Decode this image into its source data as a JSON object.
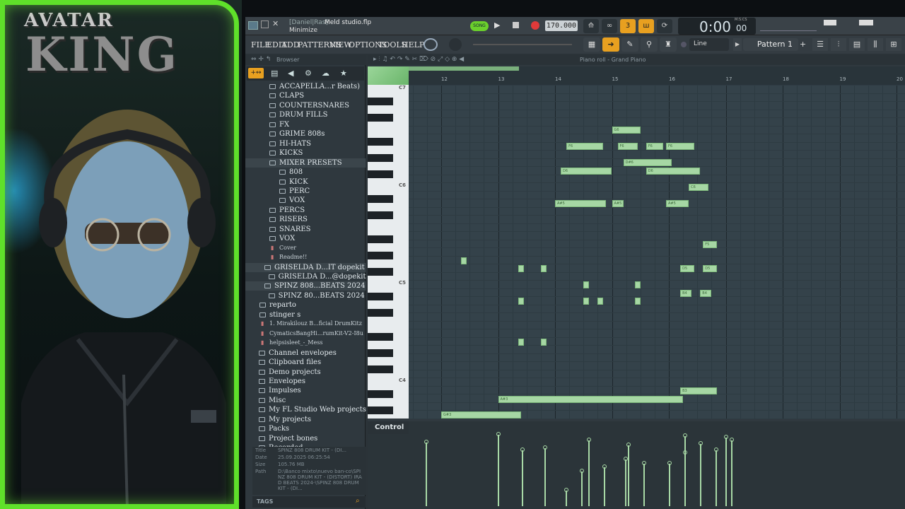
{
  "overlay": {
    "logo_top": "AVATAR",
    "logo_big": "KING"
  },
  "fl": {
    "title_user": "[Daniel|Ras]",
    "title_file": "Meld studio.flp",
    "title_hint": "Minimize",
    "song_toggle": "SONG",
    "tempo": "170.000",
    "time": "0:00",
    "time_small": "00",
    "time_unit": "M:S:CS",
    "menus": [
      "FILE",
      "EDIT",
      "ADD",
      "PATTERNS",
      "VIEW",
      "OPTIONS",
      "TOOLS",
      "HELP"
    ],
    "snap": "Line",
    "pattern": "Pattern 1",
    "browser_label": "Browser",
    "piano_roll_label": "Piano roll - Grand Piano",
    "control_label": "Control",
    "tags_label": "TAGS"
  },
  "browser_items": [
    {
      "label": "ACCAPELLA...r Beats)",
      "indent": 1
    },
    {
      "label": "CLAPS",
      "indent": 1
    },
    {
      "label": "COUNTERSNARES",
      "indent": 1
    },
    {
      "label": "DRUM FILLS",
      "indent": 1
    },
    {
      "label": "FX",
      "indent": 1
    },
    {
      "label": "GRIME 808s",
      "indent": 1
    },
    {
      "label": "HI-HATS",
      "indent": 1
    },
    {
      "label": "KICKS",
      "indent": 1
    },
    {
      "label": "MIXER PRESETS",
      "indent": 1,
      "open": true
    },
    {
      "label": "808",
      "indent": 2
    },
    {
      "label": "KICK",
      "indent": 2
    },
    {
      "label": "PERC",
      "indent": 2
    },
    {
      "label": "VOX",
      "indent": 2
    },
    {
      "label": "PERCS",
      "indent": 1
    },
    {
      "label": "RISERS",
      "indent": 1
    },
    {
      "label": "SNARES",
      "indent": 1
    },
    {
      "label": "VOX",
      "indent": 1
    },
    {
      "label": "Cover",
      "indent": 1,
      "kind": "file"
    },
    {
      "label": "Readme!!",
      "indent": 1,
      "kind": "file"
    },
    {
      "label": "GRISELDA D...IT dopekit",
      "indent": 0.5,
      "open": true
    },
    {
      "label": "GRISELDA D...@dopekit",
      "indent": 0.9
    },
    {
      "label": "SPINZ 808...BEATS 2024",
      "indent": 0.5,
      "open": true
    },
    {
      "label": "SPINZ 80...BEATS 2024",
      "indent": 0.9
    },
    {
      "label": "reparto",
      "indent": 0
    },
    {
      "label": "stinger s",
      "indent": 0
    },
    {
      "label": "1. Mirakilouz B...ficial DrumKitz",
      "indent": 0,
      "kind": "file"
    },
    {
      "label": "CymaticsBangHi...rumKit-V2-I8u",
      "indent": 0,
      "kind": "file"
    },
    {
      "label": "helpsisleet_-_Mess",
      "indent": 0,
      "kind": "file"
    },
    {
      "label": "Channel envelopes",
      "indent": -0.5
    },
    {
      "label": "Clipboard files",
      "indent": -0.5
    },
    {
      "label": "Demo projects",
      "indent": -0.5
    },
    {
      "label": "Envelopes",
      "indent": -0.5
    },
    {
      "label": "Impulses",
      "indent": -0.5
    },
    {
      "label": "Misc",
      "indent": -0.5
    },
    {
      "label": "My FL Studio Web projects",
      "indent": -0.5
    },
    {
      "label": "My projects",
      "indent": -0.5
    },
    {
      "label": "Packs",
      "indent": -0.5
    },
    {
      "label": "Project bones",
      "indent": -0.5
    },
    {
      "label": "Recorded",
      "indent": -0.5
    }
  ],
  "info": {
    "title_label": "Title",
    "title": "SPINZ 808 DRUM KIT - (DI...",
    "date_label": "Date",
    "date": "25.09.2025 06:25:54",
    "size_label": "Size",
    "size": "105.76 MB",
    "path_label": "Path",
    "path": "D:\\Banco  mixto\\nuevo ban-co\\SPINZ 808 DRUM KIT - (DISTORT) IRAD BEATS 2024-\\SPINZ 808 DRUM KIT - (DI..."
  },
  "ruler": [
    "12",
    "13",
    "14",
    "15",
    "16",
    "17",
    "18",
    "19",
    "20"
  ],
  "key_labels": [
    "C7",
    "C6",
    "C5",
    "C4"
  ],
  "notes": [
    {
      "label": "G6",
      "bar": 15.0,
      "len": 0.5,
      "row": 1
    },
    {
      "label": "F6",
      "bar": 14.2,
      "len": 0.65,
      "row": 2
    },
    {
      "label": "F6",
      "bar": 15.1,
      "len": 0.35,
      "row": 2
    },
    {
      "label": "F6",
      "bar": 15.6,
      "len": 0.3,
      "row": 2
    },
    {
      "label": "F6",
      "bar": 15.95,
      "len": 0.5,
      "row": 2
    },
    {
      "label": "D#6",
      "bar": 15.2,
      "len": 0.85,
      "row": 3
    },
    {
      "label": "D6",
      "bar": 14.1,
      "len": 0.9,
      "row": 4
    },
    {
      "label": "D6",
      "bar": 15.6,
      "len": 0.95,
      "row": 4
    },
    {
      "label": "C6",
      "bar": 16.35,
      "len": 0.35,
      "row": 5
    },
    {
      "label": "A#5",
      "bar": 14.0,
      "len": 0.9,
      "row": 6
    },
    {
      "label": "A#5",
      "bar": 15.0,
      "len": 0.2,
      "row": 6
    },
    {
      "label": "A#5",
      "bar": 15.95,
      "len": 0.4,
      "row": 6
    },
    {
      "label": "F5",
      "bar": 16.6,
      "len": 0.25,
      "row": 7
    },
    {
      "label": "",
      "bar": 12.35,
      "len": 0.1,
      "row": 8
    },
    {
      "label": "",
      "bar": 13.35,
      "len": 0.1,
      "row": 9
    },
    {
      "label": "",
      "bar": 13.75,
      "len": 0.1,
      "row": 9
    },
    {
      "label": "D5",
      "bar": 16.2,
      "len": 0.25,
      "row": 9
    },
    {
      "label": "D5",
      "bar": 16.6,
      "len": 0.25,
      "row": 9
    },
    {
      "label": "",
      "bar": 14.5,
      "len": 0.1,
      "row": 10
    },
    {
      "label": "",
      "bar": 15.4,
      "len": 0.1,
      "row": 10
    },
    {
      "label": "B4",
      "bar": 16.2,
      "len": 0.2,
      "row": 11
    },
    {
      "label": "B4",
      "bar": 16.55,
      "len": 0.2,
      "row": 11
    },
    {
      "label": "",
      "bar": 13.35,
      "len": 0.1,
      "row": 12
    },
    {
      "label": "",
      "bar": 14.5,
      "len": 0.1,
      "row": 12
    },
    {
      "label": "",
      "bar": 14.75,
      "len": 0.1,
      "row": 12
    },
    {
      "label": "",
      "bar": 15.4,
      "len": 0.1,
      "row": 12
    },
    {
      "label": "",
      "bar": 13.35,
      "len": 0.1,
      "row": 13
    },
    {
      "label": "",
      "bar": 13.75,
      "len": 0.1,
      "row": 13
    },
    {
      "label": "B3",
      "bar": 16.2,
      "len": 0.65,
      "row": 14
    },
    {
      "label": "A#3",
      "bar": 13.0,
      "len": 3.25,
      "row": 15
    },
    {
      "label": "G#3",
      "bar": 12.0,
      "len": 1.4,
      "row": 16
    }
  ],
  "velocities": [
    0.82,
    0.92,
    0.72,
    0.75,
    0.85,
    0.5,
    0.78,
    0.55,
    0.2,
    0.45,
    0.6,
    0.55,
    0.68,
    0.8,
    0.72,
    0.85,
    0.88,
    0.9
  ]
}
